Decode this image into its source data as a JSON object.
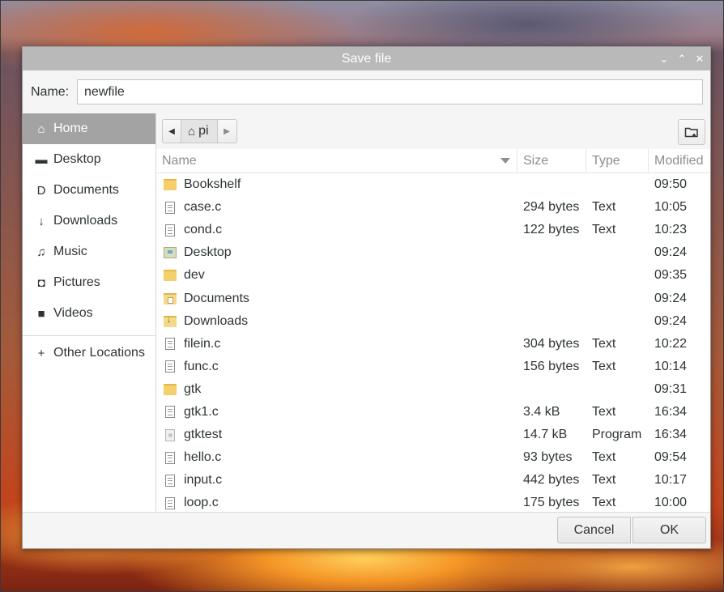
{
  "window": {
    "title": "Save file",
    "controls": {
      "minimize": "⌄",
      "maximize": "⌃",
      "close": "✕"
    }
  },
  "name_field": {
    "label": "Name:",
    "value": "newfile"
  },
  "sidebar": {
    "items": [
      {
        "label": "Home",
        "icon": "home-icon",
        "glyph": "⌂",
        "active": true
      },
      {
        "label": "Desktop",
        "icon": "folder-icon",
        "glyph": "▬"
      },
      {
        "label": "Documents",
        "icon": "document-icon",
        "glyph": "D"
      },
      {
        "label": "Downloads",
        "icon": "download-arrow-icon",
        "glyph": "↓"
      },
      {
        "label": "Music",
        "icon": "music-note-icon",
        "glyph": "♫"
      },
      {
        "label": "Pictures",
        "icon": "camera-icon",
        "glyph": "◘"
      },
      {
        "label": "Videos",
        "icon": "video-icon",
        "glyph": "■"
      }
    ],
    "other_locations": {
      "label": "Other Locations",
      "glyph": "+"
    }
  },
  "pathbar": {
    "crumb": "pi",
    "back_glyph": "◀",
    "forward_glyph": "▶"
  },
  "columns": {
    "name": "Name",
    "size": "Size",
    "type": "Type",
    "modified": "Modified"
  },
  "files": [
    {
      "name": "Bookshelf",
      "icon": "folder",
      "size": "",
      "type": "",
      "modified": "09:50"
    },
    {
      "name": "case.c",
      "icon": "text",
      "size": "294 bytes",
      "type": "Text",
      "modified": "10:05"
    },
    {
      "name": "cond.c",
      "icon": "text",
      "size": "122 bytes",
      "type": "Text",
      "modified": "10:23"
    },
    {
      "name": "Desktop",
      "icon": "folder-desktop",
      "size": "",
      "type": "",
      "modified": "09:24"
    },
    {
      "name": "dev",
      "icon": "folder",
      "size": "",
      "type": "",
      "modified": "09:35"
    },
    {
      "name": "Documents",
      "icon": "folder-documents",
      "size": "",
      "type": "",
      "modified": "09:24"
    },
    {
      "name": "Downloads",
      "icon": "folder-downloads",
      "size": "",
      "type": "",
      "modified": "09:24"
    },
    {
      "name": "filein.c",
      "icon": "text",
      "size": "304 bytes",
      "type": "Text",
      "modified": "10:22"
    },
    {
      "name": "func.c",
      "icon": "text",
      "size": "156 bytes",
      "type": "Text",
      "modified": "10:14"
    },
    {
      "name": "gtk",
      "icon": "folder",
      "size": "",
      "type": "",
      "modified": "09:31"
    },
    {
      "name": "gtk1.c",
      "icon": "text",
      "size": "3.4 kB",
      "type": "Text",
      "modified": "16:34"
    },
    {
      "name": "gtktest",
      "icon": "program",
      "size": "14.7 kB",
      "type": "Program",
      "modified": "16:34"
    },
    {
      "name": "hello.c",
      "icon": "text",
      "size": "93 bytes",
      "type": "Text",
      "modified": "09:54"
    },
    {
      "name": "input.c",
      "icon": "text",
      "size": "442 bytes",
      "type": "Text",
      "modified": "10:17"
    },
    {
      "name": "loop.c",
      "icon": "text",
      "size": "175 bytes",
      "type": "Text",
      "modified": "10:00"
    }
  ],
  "buttons": {
    "cancel": "Cancel",
    "ok": "OK"
  },
  "colors": {
    "titlebar": "#b9b9b9",
    "sidebar_active": "#a3a3a3",
    "folder": "#f4cf6b"
  }
}
